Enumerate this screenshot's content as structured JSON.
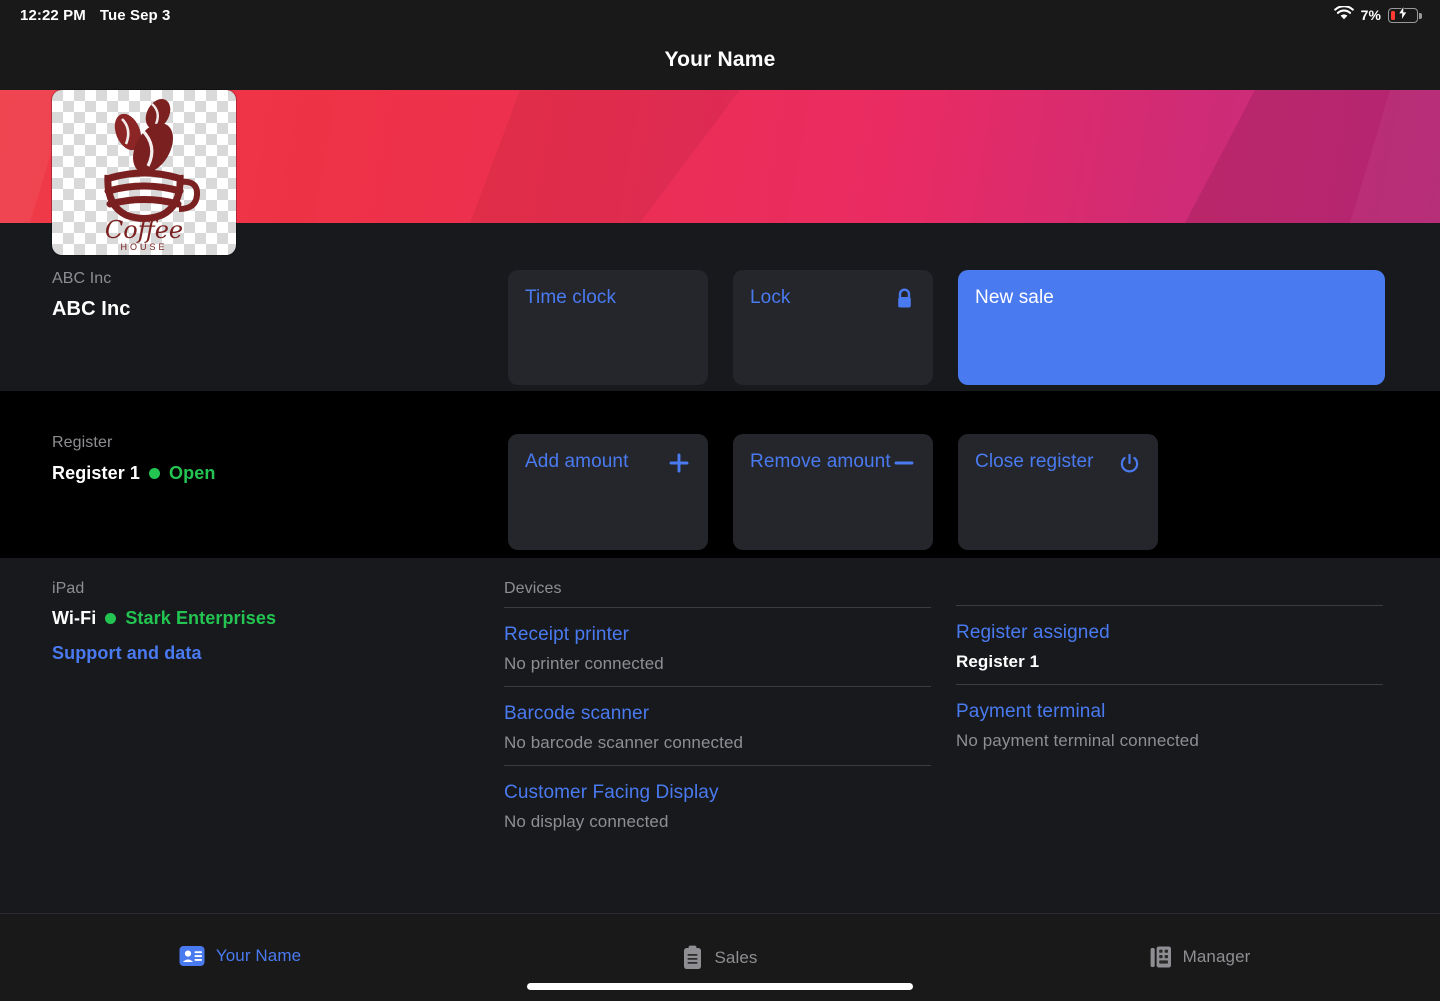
{
  "status_bar": {
    "time": "12:22 PM",
    "date": "Tue Sep 3",
    "wifi_icon": "wifi-icon",
    "battery_percent": "7%",
    "battery_icon": "battery-charging-icon"
  },
  "nav": {
    "title": "Your Name"
  },
  "banner": {
    "logo_alt": "Coffee House",
    "logo_text_main": "Coffee",
    "logo_text_sub": "HOUSE",
    "gradient_from": "#ef3b48",
    "gradient_to": "#c92a80"
  },
  "user_section": {
    "label": "ABC Inc",
    "value": "ABC Inc",
    "actions": [
      {
        "label": "Time clock",
        "icon": "",
        "style": "secondary",
        "width": "narrow"
      },
      {
        "label": "Lock",
        "icon": "lock-icon",
        "style": "secondary",
        "width": "narrow"
      },
      {
        "label": "New sale",
        "icon": "",
        "style": "primary",
        "width": "wide"
      }
    ]
  },
  "register_section": {
    "label": "Register",
    "value": "Register 1",
    "status": "Open",
    "status_color": "#23c451",
    "actions": [
      {
        "label": "Add amount",
        "icon": "plus-icon"
      },
      {
        "label": "Remove amount",
        "icon": "minus-icon"
      },
      {
        "label": "Close register",
        "icon": "power-icon"
      }
    ]
  },
  "device_section": {
    "ipad_label": "iPad",
    "wifi_label": "Wi-Fi",
    "wifi_network": "Stark Enterprises",
    "support_link": "Support and data",
    "devices_header": "Devices",
    "left_items": [
      {
        "title": "Receipt printer",
        "sub": "No printer connected"
      },
      {
        "title": "Barcode scanner",
        "sub": "No barcode scanner connected"
      },
      {
        "title": "Customer Facing Display",
        "sub": "No display connected"
      }
    ],
    "right_items": [
      {
        "title": "Register assigned",
        "sub": "Register 1",
        "strong": true
      },
      {
        "title": "Payment terminal",
        "sub": "No payment terminal connected",
        "strong": false
      }
    ]
  },
  "tabbar": {
    "tabs": [
      {
        "label": "Your Name",
        "icon": "contact-card-icon",
        "active": true
      },
      {
        "label": "Sales",
        "icon": "clipboard-icon",
        "active": false
      },
      {
        "label": "Manager",
        "icon": "building-icon",
        "active": false
      }
    ],
    "accent_color": "#4a7af0",
    "inactive_color": "#8e8e93"
  }
}
